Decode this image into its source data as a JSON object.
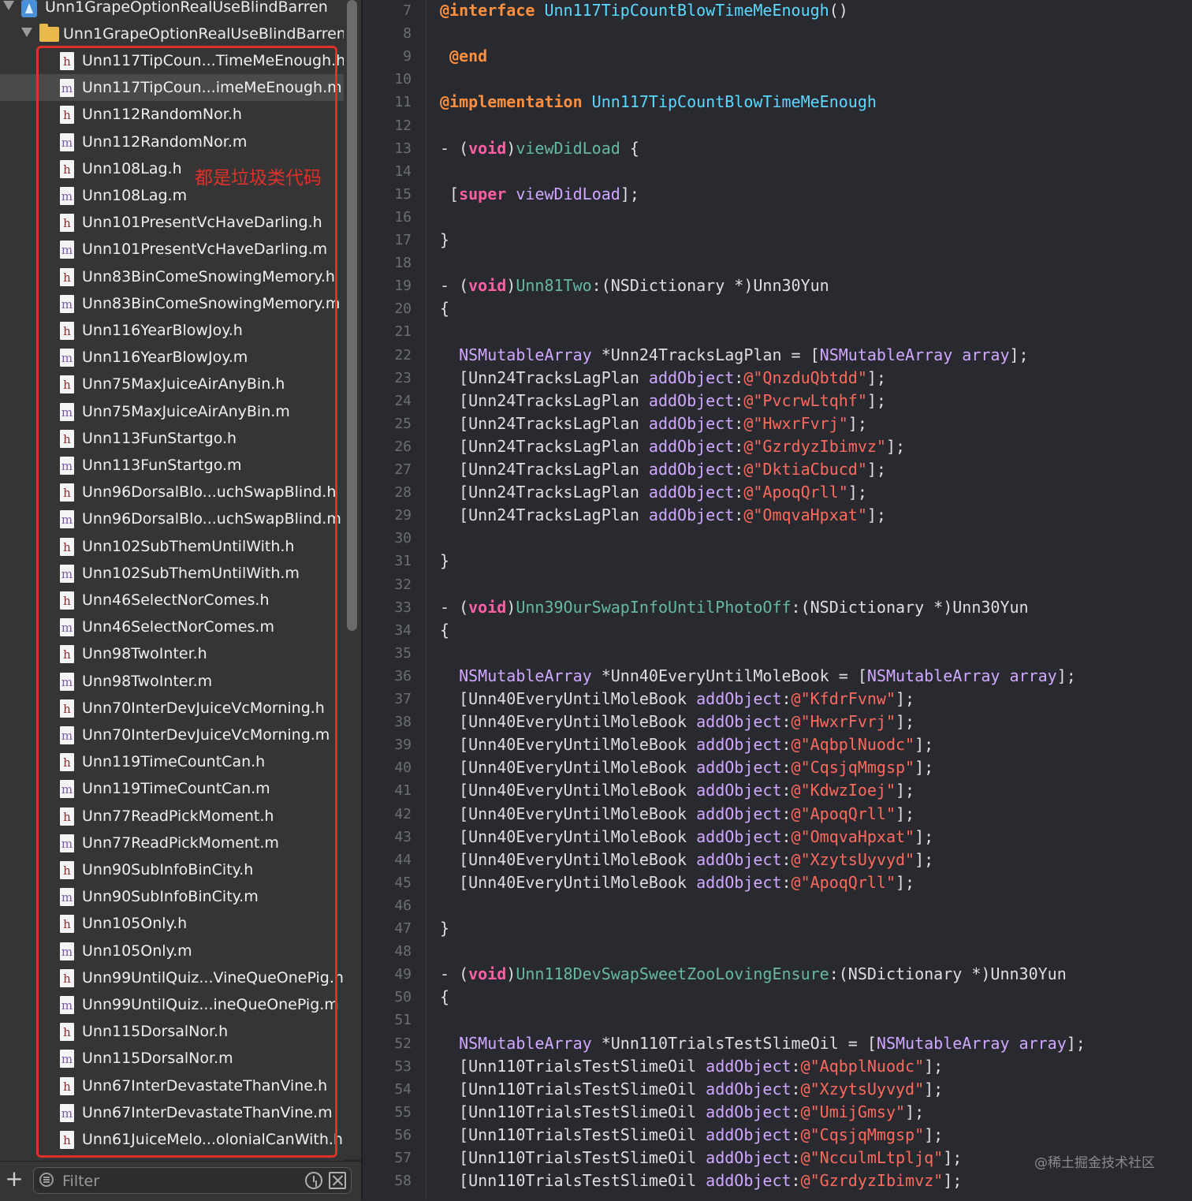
{
  "navigator": {
    "project_name": "Unn1GrapeOptionRealUseBlindBarren",
    "group_name": "Unn1GrapeOptionRealUseBlindBarren",
    "annotation": "都是垃圾类代码",
    "files": [
      {
        "name": "Unn117TipCoun...TimeMeEnough.h",
        "type": "h"
      },
      {
        "name": "Unn117TipCoun...imeMeEnough.m",
        "type": "m"
      },
      {
        "name": "Unn112RandomNor.h",
        "type": "h"
      },
      {
        "name": "Unn112RandomNor.m",
        "type": "m"
      },
      {
        "name": "Unn108Lag.h",
        "type": "h"
      },
      {
        "name": "Unn108Lag.m",
        "type": "m"
      },
      {
        "name": "Unn101PresentVcHaveDarling.h",
        "type": "h"
      },
      {
        "name": "Unn101PresentVcHaveDarling.m",
        "type": "m"
      },
      {
        "name": "Unn83BinComeSnowingMemory.h",
        "type": "h"
      },
      {
        "name": "Unn83BinComeSnowingMemory.m",
        "type": "m"
      },
      {
        "name": "Unn116YearBlowJoy.h",
        "type": "h"
      },
      {
        "name": "Unn116YearBlowJoy.m",
        "type": "m"
      },
      {
        "name": "Unn75MaxJuiceAirAnyBin.h",
        "type": "h"
      },
      {
        "name": "Unn75MaxJuiceAirAnyBin.m",
        "type": "m"
      },
      {
        "name": "Unn113FunStartgo.h",
        "type": "h"
      },
      {
        "name": "Unn113FunStartgo.m",
        "type": "m"
      },
      {
        "name": "Unn96DorsalBlo...uchSwapBlind.h",
        "type": "h"
      },
      {
        "name": "Unn96DorsalBlo...uchSwapBlind.m",
        "type": "m"
      },
      {
        "name": "Unn102SubThemUntilWith.h",
        "type": "h"
      },
      {
        "name": "Unn102SubThemUntilWith.m",
        "type": "m"
      },
      {
        "name": "Unn46SelectNorComes.h",
        "type": "h"
      },
      {
        "name": "Unn46SelectNorComes.m",
        "type": "m"
      },
      {
        "name": "Unn98TwoInter.h",
        "type": "h"
      },
      {
        "name": "Unn98TwoInter.m",
        "type": "m"
      },
      {
        "name": "Unn70InterDevJuiceVcMorning.h",
        "type": "h"
      },
      {
        "name": "Unn70InterDevJuiceVcMorning.m",
        "type": "m"
      },
      {
        "name": "Unn119TimeCountCan.h",
        "type": "h"
      },
      {
        "name": "Unn119TimeCountCan.m",
        "type": "m"
      },
      {
        "name": "Unn77ReadPickMoment.h",
        "type": "h"
      },
      {
        "name": "Unn77ReadPickMoment.m",
        "type": "m"
      },
      {
        "name": "Unn90SubInfoBinCity.h",
        "type": "h"
      },
      {
        "name": "Unn90SubInfoBinCity.m",
        "type": "m"
      },
      {
        "name": "Unn105Only.h",
        "type": "h"
      },
      {
        "name": "Unn105Only.m",
        "type": "m"
      },
      {
        "name": "Unn99UntilQuiz...VineQueOnePig.h",
        "type": "h"
      },
      {
        "name": "Unn99UntilQuiz...ineQueOnePig.m",
        "type": "m"
      },
      {
        "name": "Unn115DorsalNor.h",
        "type": "h"
      },
      {
        "name": "Unn115DorsalNor.m",
        "type": "m"
      },
      {
        "name": "Unn67InterDevastateThanVine.h",
        "type": "h"
      },
      {
        "name": "Unn67InterDevastateThanVine.m",
        "type": "m"
      },
      {
        "name": "Unn61JuiceMelo...olonialCanWith.h",
        "type": "h"
      }
    ],
    "selected_index": 1,
    "filter_placeholder": "Filter",
    "add_icon": "plus-icon",
    "recent_icon": "clock-icon",
    "scm_icon": "scm-filter-icon"
  },
  "editor": {
    "line_numbers": [
      "7",
      "8",
      "9",
      "10",
      "11",
      "12",
      "13",
      "14",
      "15",
      "16",
      "17",
      "18",
      "19",
      "20",
      "21",
      "22",
      "23",
      "24",
      "25",
      "26",
      "27",
      "28",
      "29",
      "30",
      "31",
      "32",
      "33",
      "34",
      "35",
      "36",
      "37",
      "38",
      "39",
      "40",
      "41",
      "42",
      "43",
      "44",
      "45",
      "46",
      "47",
      "48",
      "49",
      "50",
      "51",
      "52",
      "53",
      "54",
      "55",
      "56",
      "57",
      "58"
    ],
    "lines": [
      [
        [
          "dir",
          "@interface"
        ],
        [
          "pl",
          " "
        ],
        [
          "cls",
          "Unn117TipCountBlowTimeMeEnough"
        ],
        [
          "pl",
          "()"
        ]
      ],
      [],
      [
        [
          "pl",
          " "
        ],
        [
          "dir",
          "@end"
        ]
      ],
      [],
      [
        [
          "dir",
          "@implementation"
        ],
        [
          "pl",
          " "
        ],
        [
          "cls",
          "Unn117TipCountBlowTimeMeEnough"
        ]
      ],
      [],
      [
        [
          "pl",
          "- ("
        ],
        [
          "kw",
          "void"
        ],
        [
          "pl",
          ")"
        ],
        [
          "fn",
          "viewDidLoad"
        ],
        [
          "pl",
          " {"
        ]
      ],
      [],
      [
        [
          "pl",
          " ["
        ],
        [
          "kw",
          "super"
        ],
        [
          "pl",
          " "
        ],
        [
          "sys",
          "viewDidLoad"
        ],
        [
          "pl",
          "];"
        ]
      ],
      [],
      [
        [
          "pl",
          "}"
        ]
      ],
      [],
      [
        [
          "pl",
          "- ("
        ],
        [
          "kw",
          "void"
        ],
        [
          "pl",
          ")"
        ],
        [
          "fn",
          "Unn81Two"
        ],
        [
          "pl",
          ":(NSDictionary *)Unn30Yun"
        ]
      ],
      [
        [
          "pl",
          "{"
        ]
      ],
      [],
      [
        [
          "pl",
          "  "
        ],
        [
          "sys",
          "NSMutableArray"
        ],
        [
          "pl",
          " *Unn24TracksLagPlan = ["
        ],
        [
          "sys",
          "NSMutableArray"
        ],
        [
          "pl",
          " "
        ],
        [
          "sys",
          "array"
        ],
        [
          "pl",
          "];"
        ]
      ],
      [
        [
          "pl",
          "  [Unn24TracksLagPlan "
        ],
        [
          "sys",
          "addObject"
        ],
        [
          "pl",
          ":"
        ],
        [
          "str",
          "@\"QnzduQbtdd\""
        ],
        [
          "pl",
          "];"
        ]
      ],
      [
        [
          "pl",
          "  [Unn24TracksLagPlan "
        ],
        [
          "sys",
          "addObject"
        ],
        [
          "pl",
          ":"
        ],
        [
          "str",
          "@\"PvcrwLtqhf\""
        ],
        [
          "pl",
          "];"
        ]
      ],
      [
        [
          "pl",
          "  [Unn24TracksLagPlan "
        ],
        [
          "sys",
          "addObject"
        ],
        [
          "pl",
          ":"
        ],
        [
          "str",
          "@\"HwxrFvrj\""
        ],
        [
          "pl",
          "];"
        ]
      ],
      [
        [
          "pl",
          "  [Unn24TracksLagPlan "
        ],
        [
          "sys",
          "addObject"
        ],
        [
          "pl",
          ":"
        ],
        [
          "str",
          "@\"GzrdyzIbimvz\""
        ],
        [
          "pl",
          "];"
        ]
      ],
      [
        [
          "pl",
          "  [Unn24TracksLagPlan "
        ],
        [
          "sys",
          "addObject"
        ],
        [
          "pl",
          ":"
        ],
        [
          "str",
          "@\"DktiaCbucd\""
        ],
        [
          "pl",
          "];"
        ]
      ],
      [
        [
          "pl",
          "  [Unn24TracksLagPlan "
        ],
        [
          "sys",
          "addObject"
        ],
        [
          "pl",
          ":"
        ],
        [
          "str",
          "@\"ApoqQrll\""
        ],
        [
          "pl",
          "];"
        ]
      ],
      [
        [
          "pl",
          "  [Unn24TracksLagPlan "
        ],
        [
          "sys",
          "addObject"
        ],
        [
          "pl",
          ":"
        ],
        [
          "str",
          "@\"OmqvaHpxat\""
        ],
        [
          "pl",
          "];"
        ]
      ],
      [],
      [
        [
          "pl",
          "}"
        ]
      ],
      [],
      [
        [
          "pl",
          "- ("
        ],
        [
          "kw",
          "void"
        ],
        [
          "pl",
          ")"
        ],
        [
          "fn",
          "Unn39OurSwapInfoUntilPhotoOff"
        ],
        [
          "pl",
          ":(NSDictionary *)Unn30Yun"
        ]
      ],
      [
        [
          "pl",
          "{"
        ]
      ],
      [],
      [
        [
          "pl",
          "  "
        ],
        [
          "sys",
          "NSMutableArray"
        ],
        [
          "pl",
          " *Unn40EveryUntilMoleBook = ["
        ],
        [
          "sys",
          "NSMutableArray"
        ],
        [
          "pl",
          " "
        ],
        [
          "sys",
          "array"
        ],
        [
          "pl",
          "];"
        ]
      ],
      [
        [
          "pl",
          "  [Unn40EveryUntilMoleBook "
        ],
        [
          "sys",
          "addObject"
        ],
        [
          "pl",
          ":"
        ],
        [
          "str",
          "@\"KfdrFvnw\""
        ],
        [
          "pl",
          "];"
        ]
      ],
      [
        [
          "pl",
          "  [Unn40EveryUntilMoleBook "
        ],
        [
          "sys",
          "addObject"
        ],
        [
          "pl",
          ":"
        ],
        [
          "str",
          "@\"HwxrFvrj\""
        ],
        [
          "pl",
          "];"
        ]
      ],
      [
        [
          "pl",
          "  [Unn40EveryUntilMoleBook "
        ],
        [
          "sys",
          "addObject"
        ],
        [
          "pl",
          ":"
        ],
        [
          "str",
          "@\"AqbplNuodc\""
        ],
        [
          "pl",
          "];"
        ]
      ],
      [
        [
          "pl",
          "  [Unn40EveryUntilMoleBook "
        ],
        [
          "sys",
          "addObject"
        ],
        [
          "pl",
          ":"
        ],
        [
          "str",
          "@\"CqsjqMmgsp\""
        ],
        [
          "pl",
          "];"
        ]
      ],
      [
        [
          "pl",
          "  [Unn40EveryUntilMoleBook "
        ],
        [
          "sys",
          "addObject"
        ],
        [
          "pl",
          ":"
        ],
        [
          "str",
          "@\"KdwzIoej\""
        ],
        [
          "pl",
          "];"
        ]
      ],
      [
        [
          "pl",
          "  [Unn40EveryUntilMoleBook "
        ],
        [
          "sys",
          "addObject"
        ],
        [
          "pl",
          ":"
        ],
        [
          "str",
          "@\"ApoqQrll\""
        ],
        [
          "pl",
          "];"
        ]
      ],
      [
        [
          "pl",
          "  [Unn40EveryUntilMoleBook "
        ],
        [
          "sys",
          "addObject"
        ],
        [
          "pl",
          ":"
        ],
        [
          "str",
          "@\"OmqvaHpxat\""
        ],
        [
          "pl",
          "];"
        ]
      ],
      [
        [
          "pl",
          "  [Unn40EveryUntilMoleBook "
        ],
        [
          "sys",
          "addObject"
        ],
        [
          "pl",
          ":"
        ],
        [
          "str",
          "@\"XzytsUyvyd\""
        ],
        [
          "pl",
          "];"
        ]
      ],
      [
        [
          "pl",
          "  [Unn40EveryUntilMoleBook "
        ],
        [
          "sys",
          "addObject"
        ],
        [
          "pl",
          ":"
        ],
        [
          "str",
          "@\"ApoqQrll\""
        ],
        [
          "pl",
          "];"
        ]
      ],
      [],
      [
        [
          "pl",
          "}"
        ]
      ],
      [],
      [
        [
          "pl",
          "- ("
        ],
        [
          "kw",
          "void"
        ],
        [
          "pl",
          ")"
        ],
        [
          "fn",
          "Unn118DevSwapSweetZooLovingEnsure"
        ],
        [
          "pl",
          ":(NSDictionary *)Unn30Yun"
        ]
      ],
      [
        [
          "pl",
          "{"
        ]
      ],
      [],
      [
        [
          "pl",
          "  "
        ],
        [
          "sys",
          "NSMutableArray"
        ],
        [
          "pl",
          " *Unn110TrialsTestSlimeOil = ["
        ],
        [
          "sys",
          "NSMutableArray"
        ],
        [
          "pl",
          " "
        ],
        [
          "sys",
          "array"
        ],
        [
          "pl",
          "];"
        ]
      ],
      [
        [
          "pl",
          "  [Unn110TrialsTestSlimeOil "
        ],
        [
          "sys",
          "addObject"
        ],
        [
          "pl",
          ":"
        ],
        [
          "str",
          "@\"AqbplNuodc\""
        ],
        [
          "pl",
          "];"
        ]
      ],
      [
        [
          "pl",
          "  [Unn110TrialsTestSlimeOil "
        ],
        [
          "sys",
          "addObject"
        ],
        [
          "pl",
          ":"
        ],
        [
          "str",
          "@\"XzytsUyvyd\""
        ],
        [
          "pl",
          "];"
        ]
      ],
      [
        [
          "pl",
          "  [Unn110TrialsTestSlimeOil "
        ],
        [
          "sys",
          "addObject"
        ],
        [
          "pl",
          ":"
        ],
        [
          "str",
          "@\"UmijGmsy\""
        ],
        [
          "pl",
          "];"
        ]
      ],
      [
        [
          "pl",
          "  [Unn110TrialsTestSlimeOil "
        ],
        [
          "sys",
          "addObject"
        ],
        [
          "pl",
          ":"
        ],
        [
          "str",
          "@\"CqsjqMmgsp\""
        ],
        [
          "pl",
          "];"
        ]
      ],
      [
        [
          "pl",
          "  [Unn110TrialsTestSlimeOil "
        ],
        [
          "sys",
          "addObject"
        ],
        [
          "pl",
          ":"
        ],
        [
          "str",
          "@\"NcculmLtpljq\""
        ],
        [
          "pl",
          "];"
        ]
      ],
      [
        [
          "pl",
          "  [Unn110TrialsTestSlimeOil "
        ],
        [
          "sys",
          "addObject"
        ],
        [
          "pl",
          ":"
        ],
        [
          "str",
          "@\"GzrdyzIbimvz\""
        ],
        [
          "pl",
          "];"
        ]
      ]
    ]
  },
  "watermark": "@稀土掘金技术社区",
  "colors": {
    "keyword": "#fc5fa3",
    "directive": "#fd8f3f",
    "class_name": "#5dd8ff",
    "method": "#67b7a4",
    "system": "#d0a8ff",
    "string": "#fc6a5d",
    "annotation": "#e0302a"
  }
}
